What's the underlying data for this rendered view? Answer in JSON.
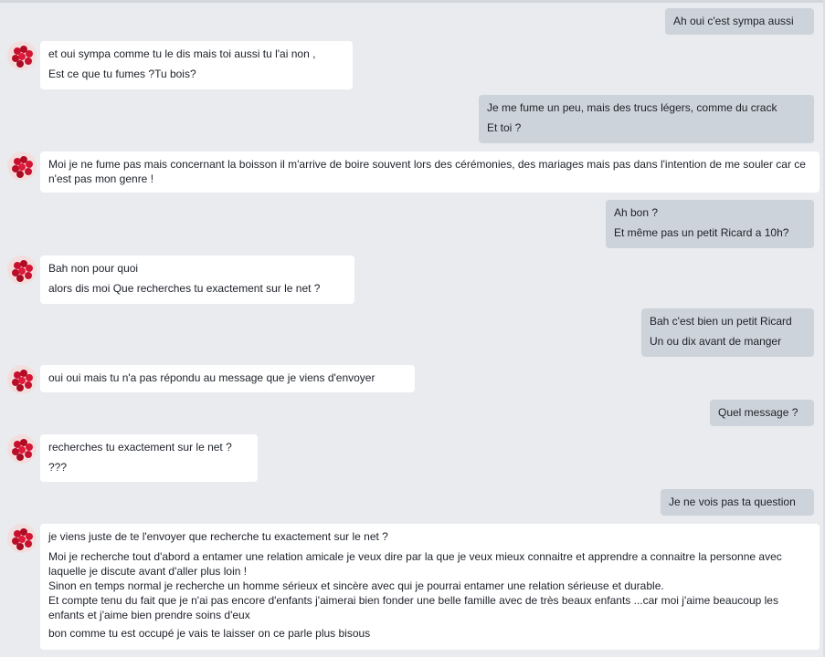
{
  "conversation": {
    "messages": [
      {
        "side": "out",
        "lines": [
          "Ah oui c'est sympa aussi"
        ]
      },
      {
        "side": "in",
        "lines": [
          "et oui sympa comme tu le dis mais toi aussi tu l'ai non ,",
          "Est ce que tu fumes ?Tu bois?"
        ]
      },
      {
        "side": "out",
        "lines": [
          "Je me fume un peu, mais des trucs légers, comme du crack",
          "Et toi ?"
        ]
      },
      {
        "side": "in",
        "lines": [
          "Moi je ne fume pas mais concernant la boisson il m'arrive de boire souvent lors des cérémonies, des mariages mais pas dans l'intention de me souler car ce n'est pas mon genre !"
        ]
      },
      {
        "side": "out",
        "lines": [
          "Ah bon ?",
          "Et même pas un petit Ricard a 10h?"
        ]
      },
      {
        "side": "in",
        "lines": [
          "Bah non pour quoi",
          "alors dis moi Que recherches tu exactement sur le net ?"
        ]
      },
      {
        "side": "out",
        "lines": [
          "Bah c'est bien un petit Ricard",
          "Un ou dix avant de manger"
        ]
      },
      {
        "side": "in",
        "lines": [
          " oui oui mais tu n'a pas répondu au message que je viens d'envoyer"
        ]
      },
      {
        "side": "out",
        "lines": [
          "Quel message ?"
        ]
      },
      {
        "side": "in",
        "lines": [
          "recherches tu exactement sur le net ?",
          "???"
        ]
      },
      {
        "side": "out",
        "lines": [
          "Je ne vois pas ta question"
        ]
      },
      {
        "side": "in",
        "lines": [
          "je viens juste de te l'envoyer que recherche tu exactement sur le net ?",
          "Moi je recherche tout d'abord a entamer une relation amicale je veux dire par la que je veux mieux connaitre et apprendre a connaitre la personne avec laquelle je discute avant d'aller plus loin !\nSinon en temps normal je recherche un homme sérieux et sincère avec qui je pourrai entamer une relation sérieuse et durable.\nEt compte tenu du fait que je n'ai pas encore d'enfants j'aimerai bien fonder une belle famille avec de très beaux enfants ...car moi j'aime beaucoup les enfants et j'aime bien prendre soins d'eux",
          " bon comme tu est occupé je vais te laisser on ce parle plus bisous"
        ]
      }
    ]
  },
  "colors": {
    "background": "#e9ebee",
    "outgoing_bubble": "#cdd3da",
    "incoming_bubble": "#ffffff",
    "text": "#1d2129",
    "avatar_accent": "#c8102e"
  },
  "icons": {
    "avatar": "raspberry-avatar-icon"
  }
}
